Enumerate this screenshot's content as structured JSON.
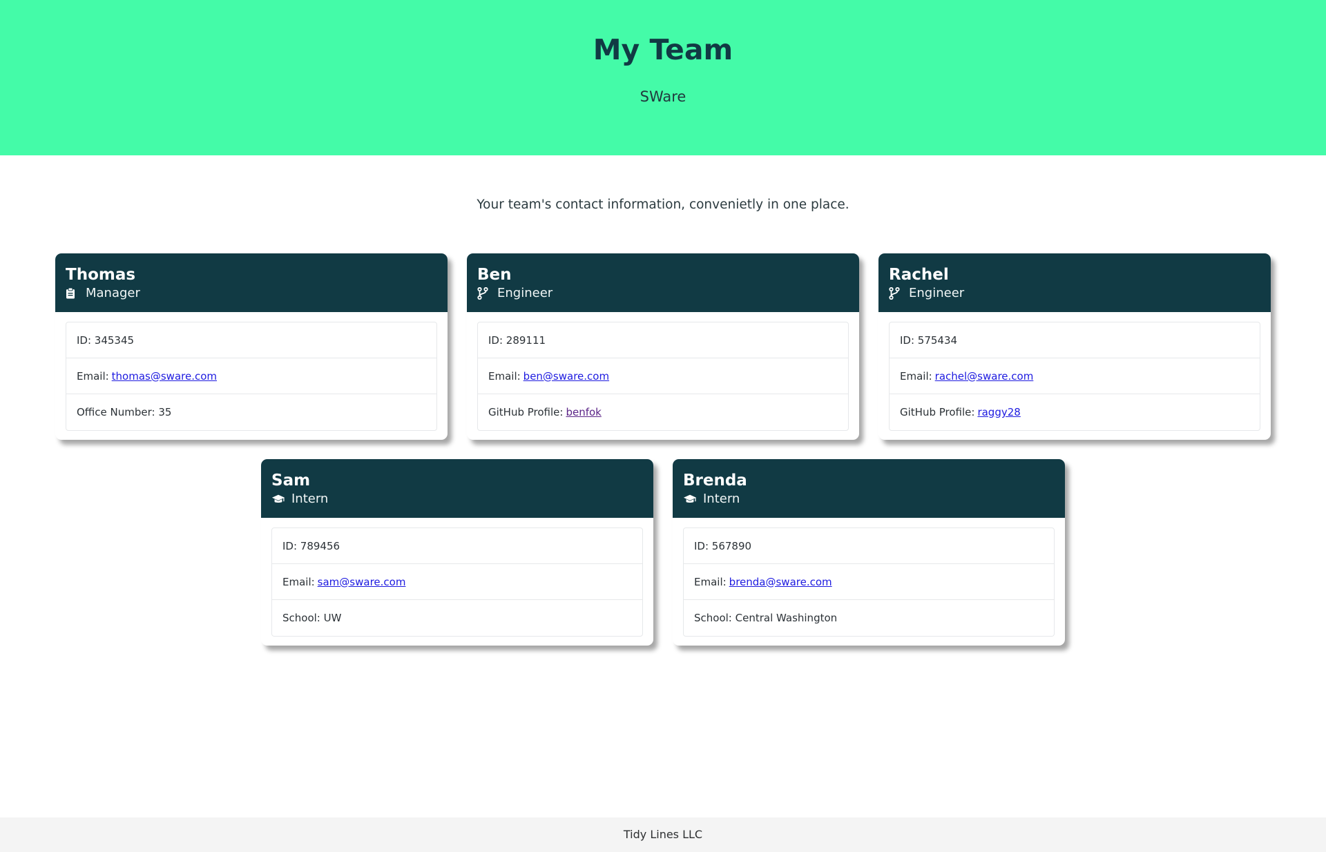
{
  "header": {
    "title": "My Team",
    "company": "SWare"
  },
  "tagline": "Your team's contact information, convenietly in one place.",
  "employees": [
    {
      "name": "Thomas",
      "role": "Manager",
      "role_icon": "clipboard-icon",
      "id_text": "ID: 345345",
      "email_label": "Email:",
      "email": "thomas@sware.com",
      "extra_label": "Office Number: 35",
      "extra_link": ""
    },
    {
      "name": "Ben",
      "role": "Engineer",
      "role_icon": "code-branch-icon",
      "id_text": "ID: 289111",
      "email_label": "Email:",
      "email": "ben@sware.com",
      "extra_label": "GitHub Profile:",
      "extra_link": "benfok"
    },
    {
      "name": "Rachel",
      "role": "Engineer",
      "role_icon": "code-branch-icon",
      "id_text": "ID: 575434",
      "email_label": "Email:",
      "email": "rachel@sware.com",
      "extra_label": "GitHub Profile:",
      "extra_link": "raggy28"
    },
    {
      "name": "Sam",
      "role": "Intern",
      "role_icon": "graduation-cap-icon",
      "id_text": "ID: 789456",
      "email_label": "Email:",
      "email": "sam@sware.com",
      "extra_label": "School: UW",
      "extra_link": ""
    },
    {
      "name": "Brenda",
      "role": "Intern",
      "role_icon": "graduation-cap-icon",
      "id_text": "ID: 567890",
      "email_label": "Email:",
      "email": "brenda@sware.com",
      "extra_label": "School: Central Washington",
      "extra_link": ""
    }
  ],
  "footer": {
    "text": "Tidy Lines LLC"
  },
  "colors": {
    "hero_bg": "#44fba8",
    "card_header_bg": "#113a44",
    "link": "#1d1ae0",
    "visited_link": "#5b2487",
    "footer_bg": "#f4f4f4"
  }
}
